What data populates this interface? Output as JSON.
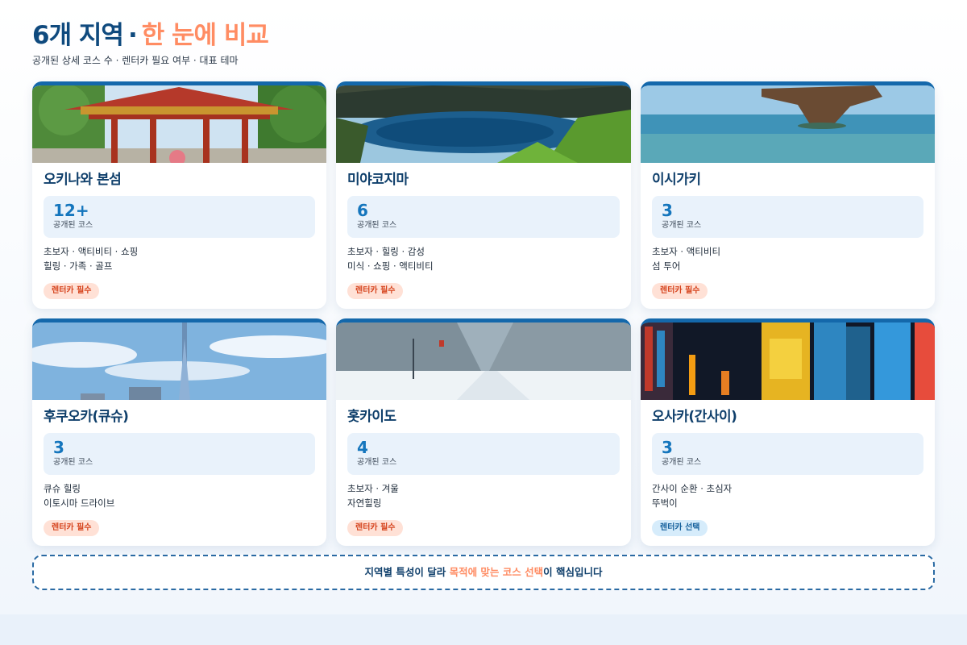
{
  "header": {
    "title_main": "6개 지역",
    "title_sep": "·",
    "title_accent": "한 눈에 비교",
    "subtitle": "공개된 상세 코스 수 · 렌터카 필요 여부 · 대표 테마"
  },
  "stat_label": "공개된 코스",
  "regions": [
    {
      "name": "오키나와 본섬",
      "count": "12+",
      "tags_line1": "초보자 · 액티비티 · 쇼핑",
      "tags_line2": "힐링 · 가족 · 골프",
      "badge": "렌터카 필수",
      "badge_type": "required",
      "image": "shuri-gate-photo"
    },
    {
      "name": "미야코지마",
      "count": "6",
      "tags_line1": "초보자 · 힐링 · 감성",
      "tags_line2": "미식 · 쇼핑 · 액티비티",
      "badge": "렌터카 필수",
      "badge_type": "required",
      "image": "blue-lagoon-cliff-photo"
    },
    {
      "name": "이시가키",
      "count": "3",
      "tags_line1": "초보자 · 액티비티",
      "tags_line2": "섬 투어",
      "badge": "렌터카 필수",
      "badge_type": "required",
      "image": "rock-in-sea-photo"
    },
    {
      "name": "후쿠오카(큐슈)",
      "count": "3",
      "tags_line1": "큐슈 힐링",
      "tags_line2": "이토시마 드라이브",
      "badge": "렌터카 필수",
      "badge_type": "required",
      "image": "fukuoka-tower-skyline-photo"
    },
    {
      "name": "홋카이도",
      "count": "4",
      "tags_line1": "초보자 · 겨울",
      "tags_line2": "자연힐링",
      "badge": "렌터카 필수",
      "badge_type": "required",
      "image": "snowy-forest-road-photo"
    },
    {
      "name": "오사카(간사이)",
      "count": "3",
      "tags_line1": "간사이 순환 · 초심자",
      "tags_line2": "뚜벅이",
      "badge": "렌터카 선택",
      "badge_type": "optional",
      "image": "dotonbori-night-signs-photo"
    }
  ],
  "footer": {
    "pre": "지역별 특성이 달라 ",
    "highlight": "목적에 맞는 코스 선택",
    "post": "이 핵심입니다"
  },
  "colors": {
    "title": "#0f4a7e",
    "accent": "#ff8c63",
    "card_top_border": "#1468ab",
    "stat_number": "#1576bd",
    "badge_required_bg": "#ffe1d6",
    "badge_required_text": "#d6451f",
    "badge_optional_bg": "#d6ecfb",
    "badge_optional_text": "#15609c"
  }
}
